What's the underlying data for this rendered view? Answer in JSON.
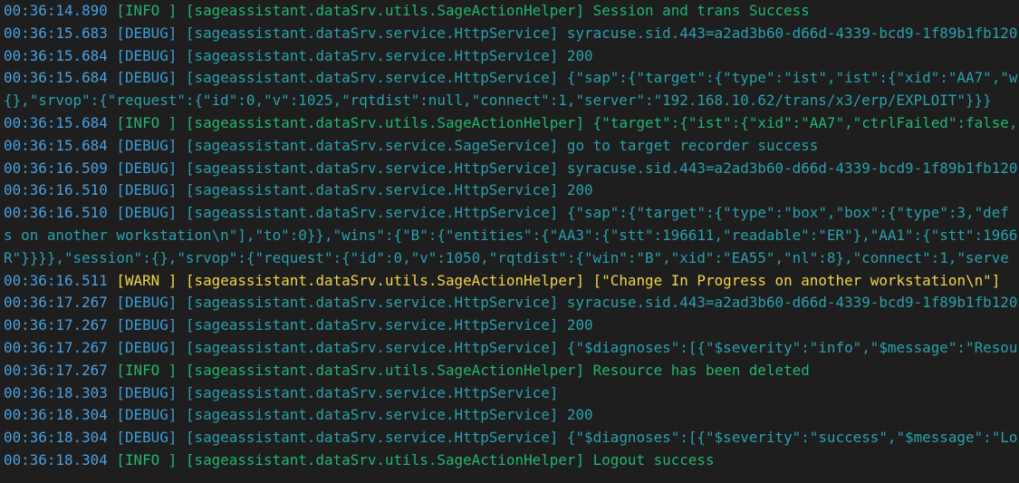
{
  "colors": {
    "background": "#1e1e1e",
    "timestamp": "#4a9fe0",
    "debug": "#29a0ad",
    "info": "#22b573",
    "warn": "#f2d24c"
  },
  "log": [
    {
      "type": "entry",
      "ts": "00:36:14.890",
      "level": "info",
      "level_label": "[INFO ]",
      "source": "[sageassistant.dataSrv.utils.SageActionHelper]",
      "message": "Session and trans Success"
    },
    {
      "type": "entry",
      "ts": "00:36:15.683",
      "level": "debug",
      "level_label": "[DEBUG]",
      "source": "[sageassistant.dataSrv.service.HttpService]",
      "message": "syracuse.sid.443=a2ad3b60-d66d-4339-bcd9-1f89b1fb120"
    },
    {
      "type": "entry",
      "ts": "00:36:15.684",
      "level": "debug",
      "level_label": "[DEBUG]",
      "source": "[sageassistant.dataSrv.service.HttpService]",
      "message": "200"
    },
    {
      "type": "entry",
      "ts": "00:36:15.684",
      "level": "debug",
      "level_label": "[DEBUG]",
      "source": "[sageassistant.dataSrv.service.HttpService]",
      "message": "{\"sap\":{\"target\":{\"type\":\"ist\",\"ist\":{\"xid\":\"AA7\",\"w"
    },
    {
      "type": "cont",
      "text": "{},\"srvop\":{\"request\":{\"id\":0,\"v\":1025,\"rqtdist\":null,\"connect\":1,\"server\":\"192.168.10.62/trans/x3/erp/EXPLOIT\"}}}"
    },
    {
      "type": "entry",
      "ts": "00:36:15.684",
      "level": "info",
      "level_label": "[INFO ]",
      "source": "[sageassistant.dataSrv.utils.SageActionHelper]",
      "message": "{\"target\":{\"ist\":{\"xid\":\"AA7\",\"ctrlFailed\":false,"
    },
    {
      "type": "entry",
      "ts": "00:36:15.684",
      "level": "debug",
      "level_label": "[DEBUG]",
      "source": "[sageassistant.dataSrv.service.SageService]",
      "message": "go to target recorder success"
    },
    {
      "type": "entry",
      "ts": "00:36:16.509",
      "level": "debug",
      "level_label": "[DEBUG]",
      "source": "[sageassistant.dataSrv.service.HttpService]",
      "message": "syracuse.sid.443=a2ad3b60-d66d-4339-bcd9-1f89b1fb120"
    },
    {
      "type": "entry",
      "ts": "00:36:16.510",
      "level": "debug",
      "level_label": "[DEBUG]",
      "source": "[sageassistant.dataSrv.service.HttpService]",
      "message": "200"
    },
    {
      "type": "entry",
      "ts": "00:36:16.510",
      "level": "debug",
      "level_label": "[DEBUG]",
      "source": "[sageassistant.dataSrv.service.HttpService]",
      "message": "{\"sap\":{\"target\":{\"type\":\"box\",\"box\":{\"type\":3,\"def"
    },
    {
      "type": "cont",
      "text": "s on another workstation\\n\"],\"to\":0}},\"wins\":{\"B\":{\"entities\":{\"AA3\":{\"stt\":196611,\"readable\":\"ER\"},\"AA1\":{\"stt\":1966"
    },
    {
      "type": "cont",
      "text": "R\"}}}},\"session\":{},\"srvop\":{\"request\":{\"id\":0,\"v\":1050,\"rqtdist\":{\"win\":\"B\",\"xid\":\"EA55\",\"nl\":8},\"connect\":1,\"serve"
    },
    {
      "type": "entry",
      "ts": "00:36:16.511",
      "level": "warn",
      "level_label": "[WARN ]",
      "source": "[sageassistant.dataSrv.utils.SageActionHelper]",
      "message": "[\"Change In Progress on another workstation\\n\"]"
    },
    {
      "type": "entry",
      "ts": "00:36:17.267",
      "level": "debug",
      "level_label": "[DEBUG]",
      "source": "[sageassistant.dataSrv.service.HttpService]",
      "message": "syracuse.sid.443=a2ad3b60-d66d-4339-bcd9-1f89b1fb120"
    },
    {
      "type": "entry",
      "ts": "00:36:17.267",
      "level": "debug",
      "level_label": "[DEBUG]",
      "source": "[sageassistant.dataSrv.service.HttpService]",
      "message": "200"
    },
    {
      "type": "entry",
      "ts": "00:36:17.267",
      "level": "debug",
      "level_label": "[DEBUG]",
      "source": "[sageassistant.dataSrv.service.HttpService]",
      "message": "{\"$diagnoses\":[{\"$severity\":\"info\",\"$message\":\"Resou"
    },
    {
      "type": "entry",
      "ts": "00:36:17.267",
      "level": "info",
      "level_label": "[INFO ]",
      "source": "[sageassistant.dataSrv.utils.SageActionHelper]",
      "message": "Resource has been deleted"
    },
    {
      "type": "entry",
      "ts": "00:36:18.303",
      "level": "debug",
      "level_label": "[DEBUG]",
      "source": "[sageassistant.dataSrv.service.HttpService]",
      "message": ""
    },
    {
      "type": "entry",
      "ts": "00:36:18.304",
      "level": "debug",
      "level_label": "[DEBUG]",
      "source": "[sageassistant.dataSrv.service.HttpService]",
      "message": "200"
    },
    {
      "type": "entry",
      "ts": "00:36:18.304",
      "level": "debug",
      "level_label": "[DEBUG]",
      "source": "[sageassistant.dataSrv.service.HttpService]",
      "message": "{\"$diagnoses\":[{\"$severity\":\"success\",\"$message\":\"Lo"
    },
    {
      "type": "entry",
      "ts": "00:36:18.304",
      "level": "info",
      "level_label": "[INFO ]",
      "source": "[sageassistant.dataSrv.utils.SageActionHelper]",
      "message": "Logout success"
    }
  ]
}
